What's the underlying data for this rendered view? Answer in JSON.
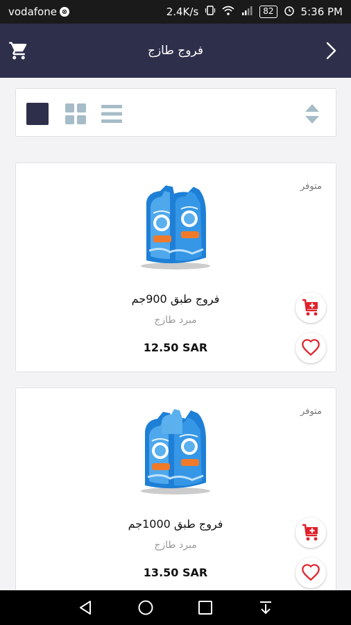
{
  "status_bar": {
    "carrier": "vodafone",
    "network_speed": "2.4K/s",
    "battery": "82",
    "time": "5:36 PM"
  },
  "header": {
    "title": "فروج طازج"
  },
  "products": [
    {
      "availability": "متوفر",
      "name": "فروج طبق 900جم",
      "category": "مبرد طازج",
      "price": "12.50 SAR"
    },
    {
      "availability": "متوفر",
      "name": "فروج طبق 1000جم",
      "category": "مبرد طازج",
      "price": "13.50 SAR"
    }
  ],
  "icons": {
    "cart": "shopping-cart-icon",
    "back": "chevron-right-icon",
    "add_to_cart": "add-to-cart-icon",
    "favorite": "heart-icon"
  },
  "colors": {
    "header_bg": "#2e2f4a",
    "accent_red": "#e0202a",
    "view_icon_inactive": "#a6bcc8"
  }
}
